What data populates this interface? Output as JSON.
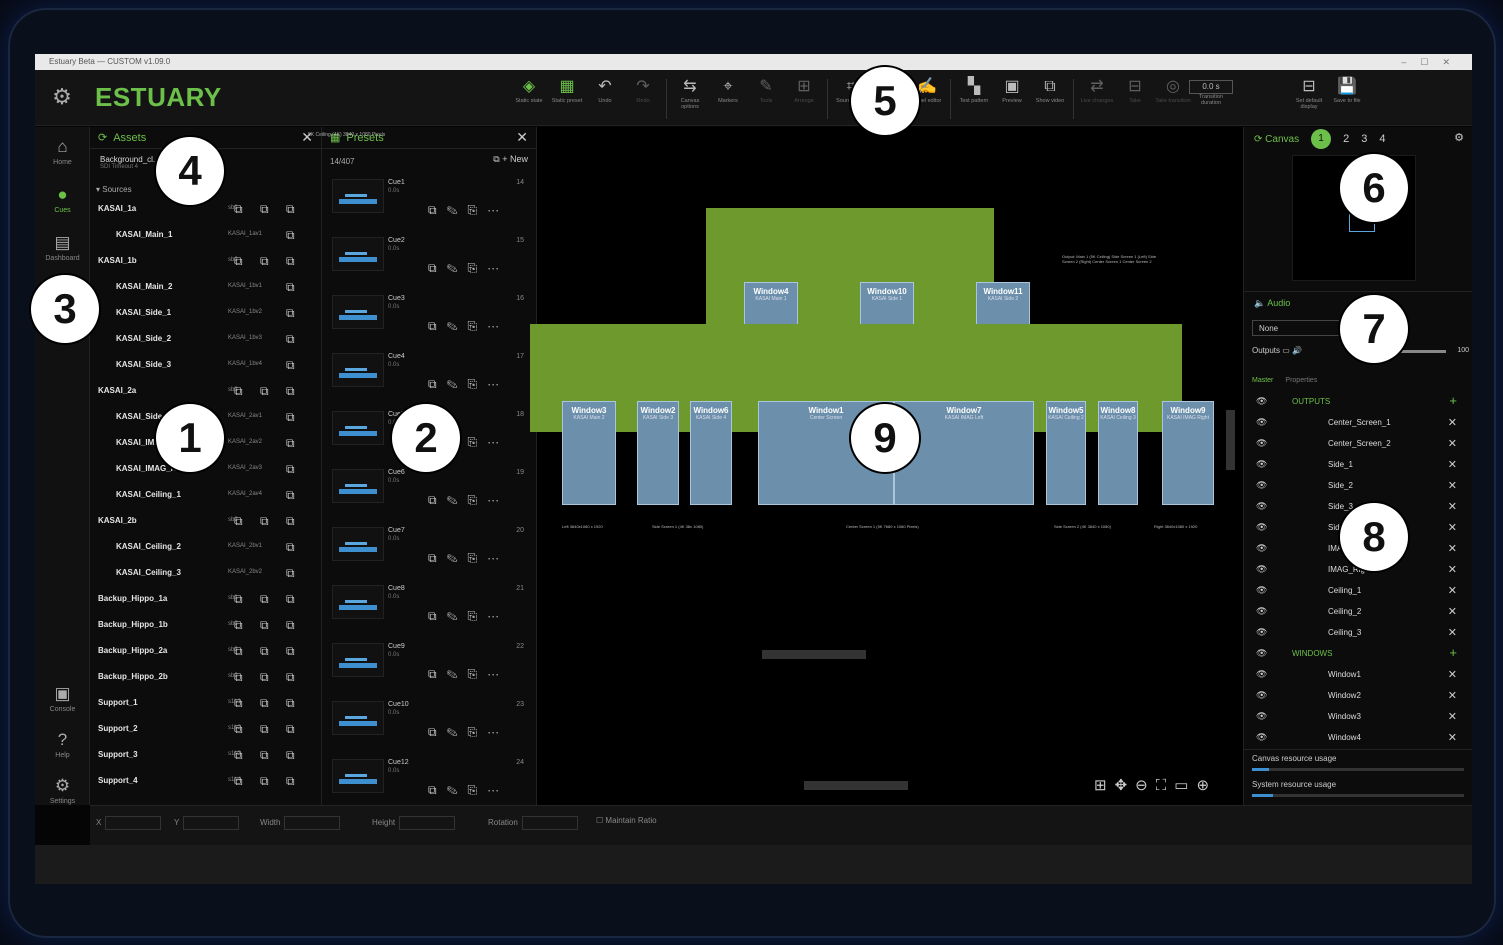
{
  "window_title": "Estuary Beta — CUSTOM v1.09.0",
  "brand": "ESTUARY",
  "toolbar": [
    {
      "icon": "monitor-icon",
      "label": "Static state",
      "tone": "green"
    },
    {
      "icon": "layout-icon",
      "label": "Static preset",
      "tone": "green"
    },
    {
      "icon": "undo-icon",
      "label": "Undo",
      "tone": ""
    },
    {
      "icon": "redo-icon",
      "label": "Redo",
      "tone": "dim"
    },
    {
      "icon": "canvas-options-icon",
      "label": "Canvas options",
      "tone": ""
    },
    {
      "icon": "markers-icon",
      "label": "Markers",
      "tone": ""
    },
    {
      "icon": "tools-icon",
      "label": "Tools",
      "tone": "dim"
    },
    {
      "icon": "arrange-icon",
      "label": "Arrange",
      "tone": "dim"
    },
    {
      "icon": "source-crop-icon",
      "label": "Source crop",
      "tone": ""
    },
    {
      "icon": "canvas-match-icon",
      "label": "Canvas match",
      "tone": ""
    },
    {
      "icon": "label-editor-icon",
      "label": "Label editor",
      "tone": ""
    },
    {
      "icon": "test-pattern-icon",
      "label": "Test pattern",
      "tone": ""
    },
    {
      "icon": "preview-icon",
      "label": "Preview",
      "tone": ""
    },
    {
      "icon": "show-video-icon",
      "label": "Show video",
      "tone": ""
    },
    {
      "icon": "live-changes-icon",
      "label": "Live changes",
      "tone": "dim"
    },
    {
      "icon": "take-icon",
      "label": "Take",
      "tone": "dim"
    },
    {
      "icon": "take-transition-icon",
      "label": "Take transition",
      "tone": "dim"
    }
  ],
  "transition": {
    "value": "0.0 s",
    "label": "Transition duration"
  },
  "toolbar_right": [
    {
      "icon": "set-default-display-icon",
      "label": "Set default display"
    },
    {
      "icon": "save-icon",
      "label": "Save to file"
    }
  ],
  "nav": [
    {
      "icon": "home-icon",
      "glyph": "⌂",
      "label": "Home",
      "active": false
    },
    {
      "icon": "cues-icon",
      "glyph": "●",
      "label": "Cues",
      "active": true
    },
    {
      "icon": "dashboard-icon",
      "glyph": "▤",
      "label": "Dashboard",
      "active": false
    }
  ],
  "nav_bottom": [
    {
      "icon": "console-icon",
      "glyph": "▣",
      "label": "Console"
    },
    {
      "icon": "help-icon",
      "glyph": "?",
      "label": "Help"
    },
    {
      "icon": "settings-icon",
      "glyph": "⚙",
      "label": "Settings"
    }
  ],
  "assets": {
    "title": "Assets",
    "backline": "Background_cl...",
    "backline_sub": "SDI Timeout 4",
    "sources_label": "Sources",
    "rows": [
      {
        "name": "KASAI_1a",
        "code": "sb1",
        "child": false
      },
      {
        "name": "KASAI_Main_1",
        "code": "KASAI_1av1",
        "child": true
      },
      {
        "name": "KASAI_1b",
        "code": "sb2",
        "child": false
      },
      {
        "name": "KASAI_Main_2",
        "code": "KASAI_1bv1",
        "child": true
      },
      {
        "name": "KASAI_Side_1",
        "code": "KASAI_1bv2",
        "child": true
      },
      {
        "name": "KASAI_Side_2",
        "code": "KASAI_1bv3",
        "child": true
      },
      {
        "name": "KASAI_Side_3",
        "code": "KASAI_1bv4",
        "child": true
      },
      {
        "name": "KASAI_2a",
        "code": "sb3",
        "child": false
      },
      {
        "name": "KASAI_Side_4",
        "code": "KASAI_2av1",
        "child": true
      },
      {
        "name": "KASAI_IMAG_Left",
        "code": "KASAI_2av2",
        "child": true
      },
      {
        "name": "KASAI_IMAG_Right",
        "code": "KASAI_2av3",
        "child": true
      },
      {
        "name": "KASAI_Ceiling_1",
        "code": "KASAI_2av4",
        "child": true
      },
      {
        "name": "KASAI_2b",
        "code": "sb2",
        "child": false
      },
      {
        "name": "KASAI_Ceiling_2",
        "code": "KASAI_2bv1",
        "child": true
      },
      {
        "name": "KASAI_Ceiling_3",
        "code": "KASAI_2bv2",
        "child": true
      },
      {
        "name": "Backup_Hippo_1a",
        "code": "sb1",
        "child": false
      },
      {
        "name": "Backup_Hippo_1b",
        "code": "sb2",
        "child": false
      },
      {
        "name": "Backup_Hippo_2a",
        "code": "sb3",
        "child": false
      },
      {
        "name": "Backup_Hippo_2b",
        "code": "sb2",
        "child": false
      },
      {
        "name": "Support_1",
        "code": "s1h1",
        "child": false
      },
      {
        "name": "Support_2",
        "code": "s1h2",
        "child": false
      },
      {
        "name": "Support_3",
        "code": "s1h3",
        "child": false
      },
      {
        "name": "Support_4",
        "code": "s1h4",
        "child": false
      }
    ]
  },
  "presets": {
    "title": "Presets",
    "count": "14/407",
    "new_label": "New",
    "rows": [
      {
        "name": "Cue1",
        "sub": "0.0s",
        "num": "14"
      },
      {
        "name": "Cue2",
        "sub": "0.0s",
        "num": "15"
      },
      {
        "name": "Cue3",
        "sub": "0.0s",
        "num": "16"
      },
      {
        "name": "Cue4",
        "sub": "0.0s",
        "num": "17"
      },
      {
        "name": "Cue5",
        "sub": "0.0s",
        "num": "18"
      },
      {
        "name": "Cue6",
        "sub": "0.0s",
        "num": "19"
      },
      {
        "name": "Cue7",
        "sub": "0.0s",
        "num": "20"
      },
      {
        "name": "Cue8",
        "sub": "0.0s",
        "num": "21"
      },
      {
        "name": "Cue9",
        "sub": "0.0s",
        "num": "22"
      },
      {
        "name": "Cue10",
        "sub": "0.0s",
        "num": "23"
      },
      {
        "name": "Cue12",
        "sub": "0.0s",
        "num": "24"
      }
    ]
  },
  "canvas": {
    "top_label": "5K Ceiling (4K) 3840 x 1080 Pixels",
    "upper_windows": [
      {
        "name": "Window4",
        "sub": "KASAI Main 1"
      },
      {
        "name": "Window10",
        "sub": "KASAI Side 1"
      },
      {
        "name": "Window11",
        "sub": "KASAI Side 2"
      }
    ],
    "strip_windows": [
      {
        "name": "Window3",
        "sub": "KASAI Main 2"
      },
      {
        "name": "Window2",
        "sub": "KASAI Side 3"
      },
      {
        "name": "Window6",
        "sub": "KASAI Side 4"
      },
      {
        "name": "Window1",
        "sub": "Center Screen"
      },
      {
        "name": "Window7",
        "sub": "KASAI IMAG Left"
      },
      {
        "name": "Window5",
        "sub": "KASAI Ceiling 2"
      },
      {
        "name": "Window8",
        "sub": "KASAI Ceiling 3"
      },
      {
        "name": "Window9",
        "sub": "KASAI IMAG Right"
      }
    ],
    "note": "Output: Main 1 (5K Ceiling) Side Screen 1 (Left) Side Screen 2 (Right) Center Screen 1 Center Screen 2",
    "bottom_labels": [
      "Left 3840x1080 x 1920",
      "Side Screen 1 (4K 38x 1080)",
      "Center Screen 1 (5K 7680 x 1080 Pixels)",
      "Side Screen 2 (4K 3840 x 1080)",
      "Right 3840x1080 x 1920"
    ]
  },
  "canvas_panel": {
    "label": "Canvas",
    "tabs": [
      "1",
      "2",
      "3",
      "4"
    ],
    "active_tab": "1"
  },
  "audio": {
    "title": "Audio",
    "select": "None",
    "outputs_label": "Outputs",
    "volume": "100"
  },
  "layers": {
    "tabs": [
      "Master",
      "Properties"
    ],
    "groups": [
      {
        "name": "OUTPUTS",
        "items": [
          "Center_Screen_1",
          "Center_Screen_2",
          "Side_1",
          "Side_2",
          "Side_3",
          "Side_4",
          "IMAG_Left",
          "IMAG_Right",
          "Ceiling_1",
          "Ceiling_2",
          "Ceiling_3"
        ]
      },
      {
        "name": "WINDOWS",
        "items": [
          "Window1",
          "Window2",
          "Window3",
          "Window4"
        ]
      }
    ]
  },
  "usage": [
    {
      "label": "Canvas resource usage",
      "value": 0.08
    },
    {
      "label": "System resource usage",
      "value": 0.1
    }
  ],
  "transform": {
    "x": "X",
    "y": "Y",
    "width": "Width",
    "height": "Height",
    "rotation": "Rotation",
    "maintain": "Maintain Ratio"
  },
  "callouts": [
    "1",
    "2",
    "3",
    "4",
    "5",
    "6",
    "7",
    "8",
    "9"
  ],
  "colors": {
    "accent": "#6cc04a",
    "window": "#6c90ab",
    "stage_green": "#6e9a2d"
  }
}
